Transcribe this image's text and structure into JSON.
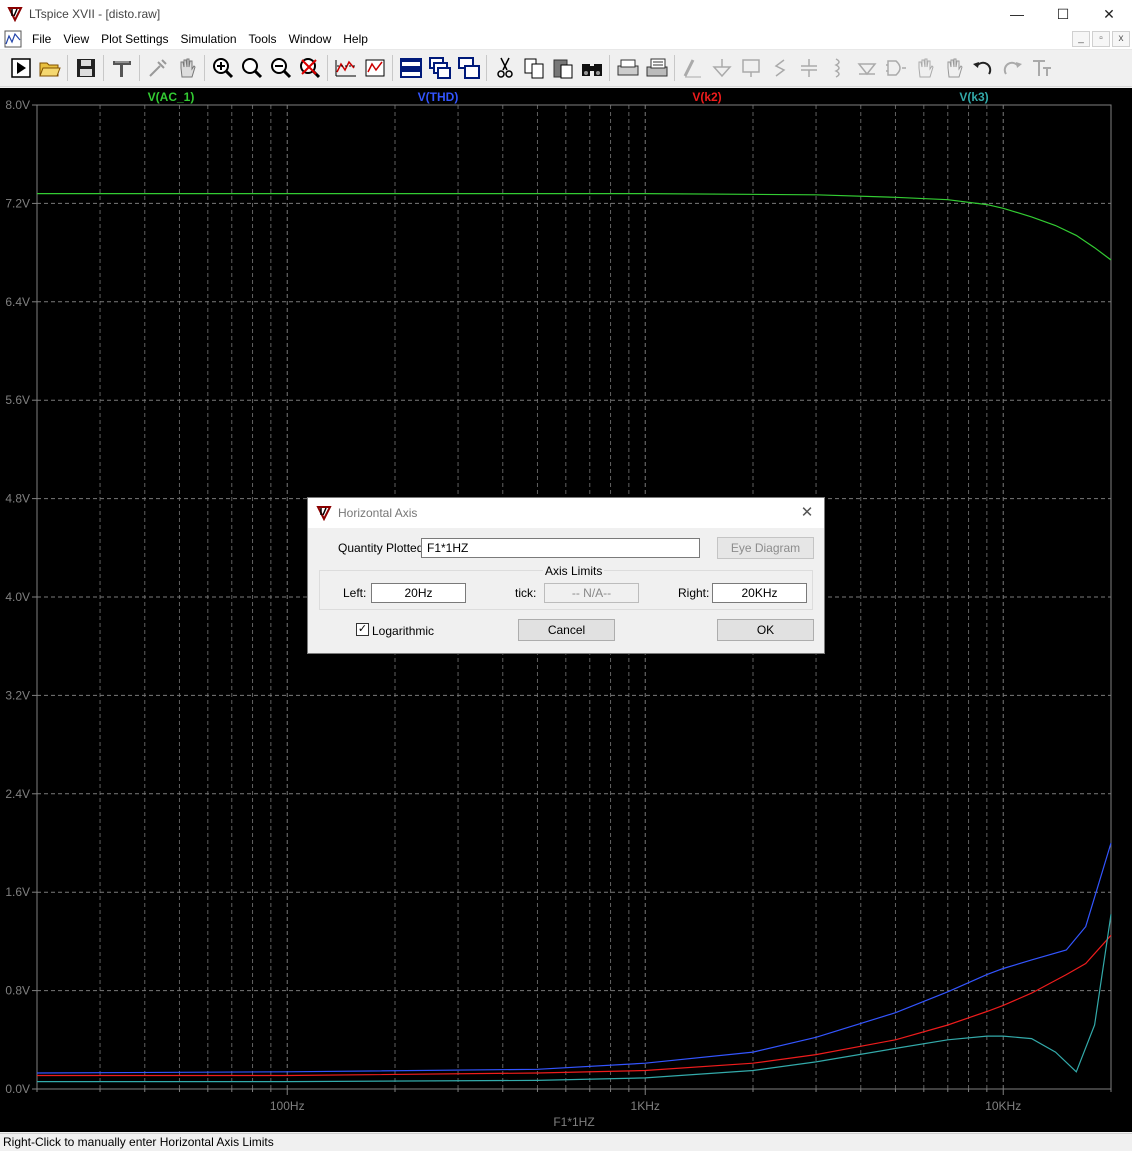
{
  "window": {
    "title": "LTspice XVII - [disto.raw]",
    "controls": {
      "minimize": "—",
      "maximize": "☐",
      "close": "✕"
    }
  },
  "menu": {
    "items": [
      "File",
      "View",
      "Plot Settings",
      "Simulation",
      "Tools",
      "Window",
      "Help"
    ],
    "mdi_controls": [
      "_",
      "▫",
      "x"
    ]
  },
  "toolbar": {
    "icons": [
      "run-icon",
      "open-icon",
      "save-icon",
      "control-panel-icon",
      "probe-icon",
      "pan-hand-icon",
      "zoom-in-icon",
      "zoom-area-icon",
      "zoom-out-icon",
      "zoom-cancel-icon",
      "autorange-icon",
      "zoom-fit-icon",
      "tile-horizontal-icon",
      "cascade-icon",
      "tile-vertical-icon",
      "cut-icon",
      "copy-icon",
      "paste-icon",
      "find-icon",
      "print-preview-icon",
      "print-icon",
      "wire-icon",
      "ground-icon",
      "label-icon",
      "resistor-icon",
      "capacitor-icon",
      "inductor-icon",
      "diode-icon",
      "component-icon",
      "move-icon",
      "drag-icon",
      "undo-icon",
      "redo-icon",
      "text-icon"
    ]
  },
  "plot": {
    "background": "#000000",
    "grid_color": "#7a7a7a",
    "traces": [
      {
        "name": "V(AC_1)",
        "color": "#33cc33"
      },
      {
        "name": "V(THD)",
        "color": "#3355ff"
      },
      {
        "name": "V(k2)",
        "color": "#ee1c1c"
      },
      {
        "name": "V(k3)",
        "color": "#33aaaa"
      }
    ],
    "y_ticks": [
      "8.0V",
      "7.2V",
      "6.4V",
      "5.6V",
      "4.8V",
      "4.0V",
      "3.2V",
      "2.4V",
      "1.6V",
      "0.8V",
      "0.0V"
    ],
    "x_ticks": [
      "100Hz",
      "1KHz",
      "10KHz"
    ],
    "x_label": "F1*1HZ"
  },
  "chart_data": {
    "type": "line",
    "xscale": "log",
    "xlim": [
      20,
      20000
    ],
    "ylim": [
      0,
      8
    ],
    "xlabel": "F1*1HZ",
    "series": [
      {
        "name": "V(AC_1)",
        "color": "#33cc33",
        "x": [
          20,
          100,
          500,
          1000,
          3000,
          5000,
          7000,
          9000,
          10000,
          12000,
          14000,
          16000,
          18000,
          20000
        ],
        "y": [
          7.28,
          7.28,
          7.28,
          7.28,
          7.27,
          7.25,
          7.23,
          7.19,
          7.16,
          7.09,
          7.02,
          6.94,
          6.84,
          6.74
        ]
      },
      {
        "name": "V(THD)",
        "color": "#3355ff",
        "x": [
          20,
          100,
          500,
          1000,
          2000,
          3000,
          5000,
          7000,
          9000,
          10000,
          12000,
          15000,
          17000,
          20000
        ],
        "y": [
          0.13,
          0.14,
          0.16,
          0.21,
          0.3,
          0.42,
          0.62,
          0.79,
          0.93,
          0.98,
          1.05,
          1.13,
          1.32,
          2.0
        ]
      },
      {
        "name": "V(k2)",
        "color": "#ee1c1c",
        "x": [
          20,
          100,
          500,
          1000,
          2000,
          3000,
          5000,
          7000,
          9000,
          10000,
          12000,
          15000,
          17000,
          20000
        ],
        "y": [
          0.11,
          0.11,
          0.13,
          0.15,
          0.21,
          0.28,
          0.4,
          0.52,
          0.63,
          0.68,
          0.78,
          0.93,
          1.02,
          1.25
        ]
      },
      {
        "name": "V(k3)",
        "color": "#33aaaa",
        "x": [
          20,
          100,
          500,
          1000,
          2000,
          3000,
          5000,
          7000,
          9000,
          10000,
          12000,
          14000,
          16000,
          18000,
          20000
        ],
        "y": [
          0.06,
          0.06,
          0.07,
          0.09,
          0.15,
          0.22,
          0.33,
          0.4,
          0.43,
          0.43,
          0.41,
          0.3,
          0.14,
          0.52,
          1.42
        ]
      }
    ]
  },
  "dialog": {
    "title": "Horizontal Axis",
    "close": "✕",
    "quantity_label": "Quantity Plotted:",
    "quantity_value": "F1*1HZ",
    "eye_button": "Eye Diagram",
    "group_label": "Axis Limits",
    "left_label": "Left:",
    "left_value": "20Hz",
    "tick_label": "tick:",
    "tick_value": "-- N/A--",
    "right_label": "Right:",
    "right_value": "20KHz",
    "log_label": "Logarithmic",
    "log_checked": "✓",
    "cancel": "Cancel",
    "ok": "OK"
  },
  "status": {
    "text": "Right-Click to manually enter Horizontal Axis Limits"
  }
}
